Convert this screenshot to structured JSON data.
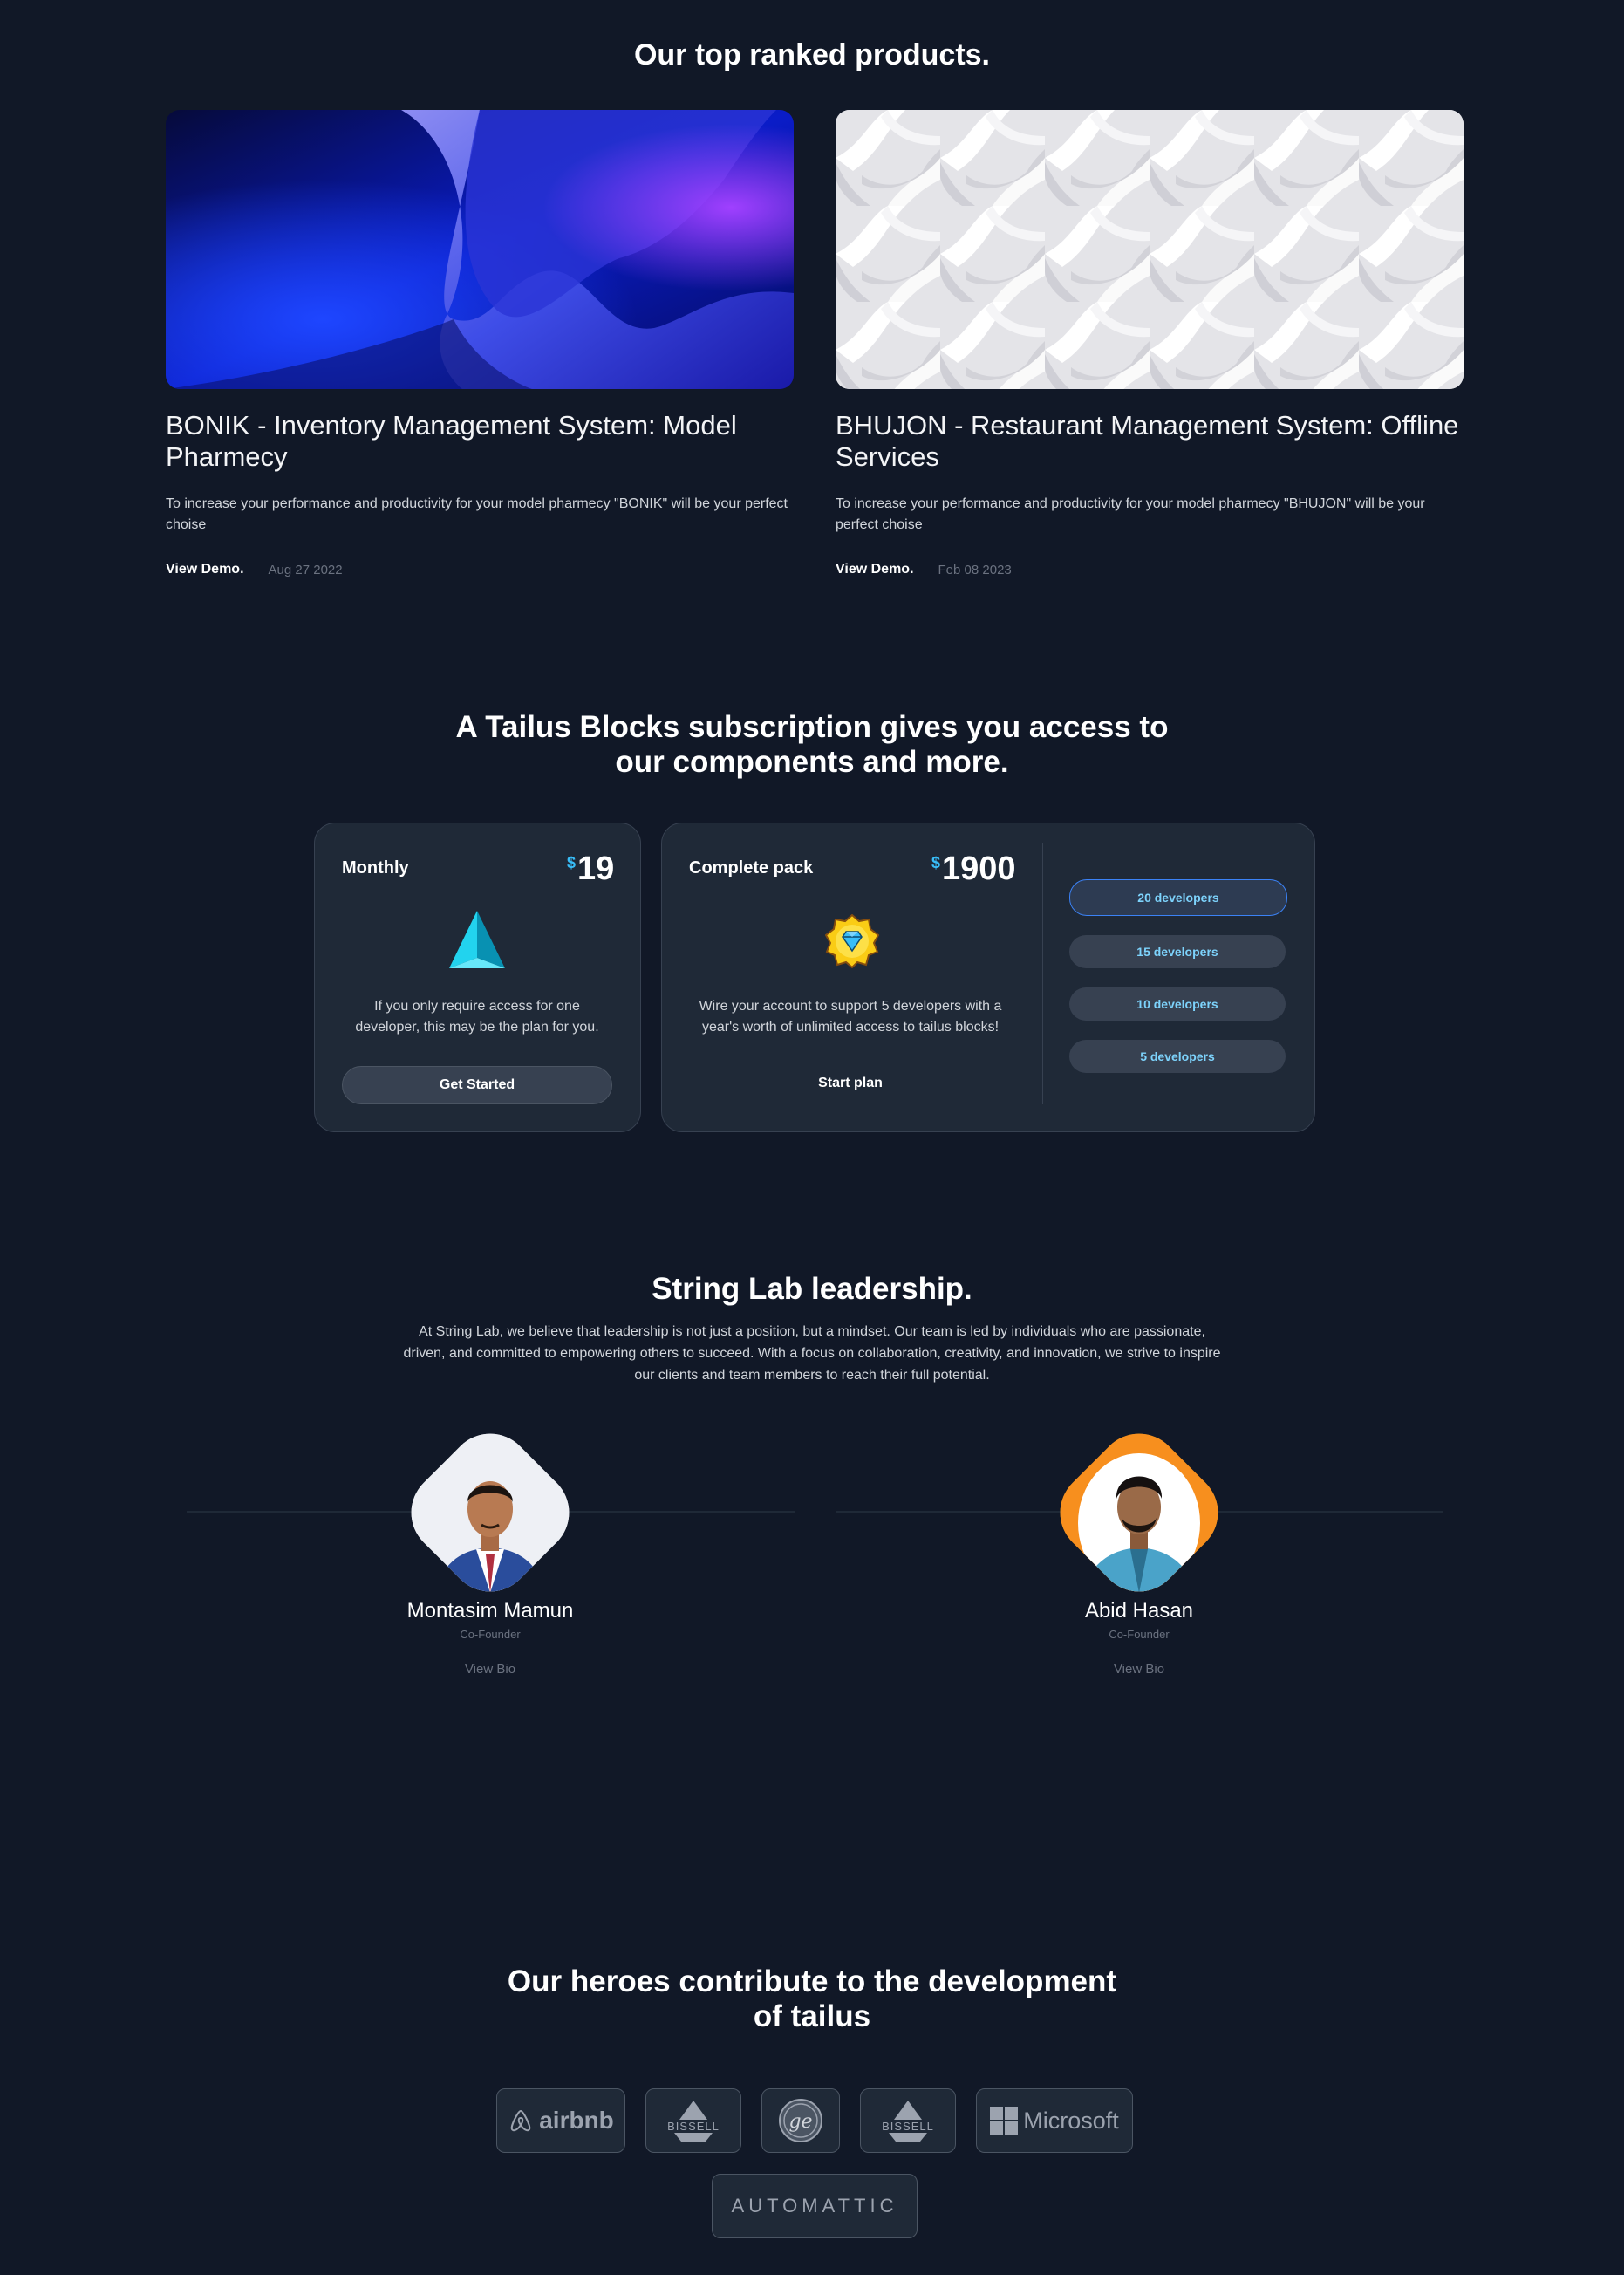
{
  "products": {
    "heading": "Our top ranked products.",
    "items": [
      {
        "title": "BONIK - Inventory Management System: Model Pharmecy",
        "description": "To increase your performance and productivity for your model pharmecy \"BONIK\" will be your perfect choise",
        "cta": "View Demo.",
        "date": "Aug 27 2022"
      },
      {
        "title": "BHUJON - Restaurant Management System: Offline Services",
        "description": "To increase your performance and productivity for your model pharmecy \"BHUJON\" will be your perfect choise",
        "cta": "View Demo.",
        "date": "Feb 08 2023"
      }
    ]
  },
  "pricing": {
    "heading_line1": "A Tailus Blocks subscription gives you access to",
    "heading_line2": "our components and more.",
    "currency": "$",
    "monthly": {
      "name": "Monthly",
      "price": "19",
      "description": "If you only require access for one developer, this may be the plan for you.",
      "button": "Get Started"
    },
    "complete": {
      "name": "Complete pack",
      "price": "1900",
      "description": "Wire your account to support 5 developers with a year's worth of unlimited access to tailus blocks!",
      "button": "Start plan",
      "options": [
        "20 developers",
        "15 developers",
        "10 developers",
        "5 developers"
      ]
    }
  },
  "leadership": {
    "heading": "String Lab leadership.",
    "intro": "At String Lab, we believe that leadership is not just a position, but a mindset. Our team is led by individuals who are passionate, driven, and committed to empowering others to succeed. With a focus on collaboration, creativity, and innovation, we strive to inspire our clients and team members to reach their full potential.",
    "people": [
      {
        "name": "Montasim Mamun",
        "role": "Co-Founder",
        "link": "View Bio"
      },
      {
        "name": "Abid Hasan",
        "role": "Co-Founder",
        "link": "View Bio"
      }
    ]
  },
  "heroes": {
    "heading_line1": "Our heroes contribute to the development",
    "heading_line2": "of tailus",
    "logos": {
      "airbnb": "airbnb",
      "bissell": "BISSELL",
      "ge": "ge",
      "microsoft": "Microsoft",
      "automattic": "AUTOMATTIC"
    }
  },
  "colors": {
    "background": "#111827",
    "card": "#1f2937",
    "accent": "#38bdf8"
  }
}
